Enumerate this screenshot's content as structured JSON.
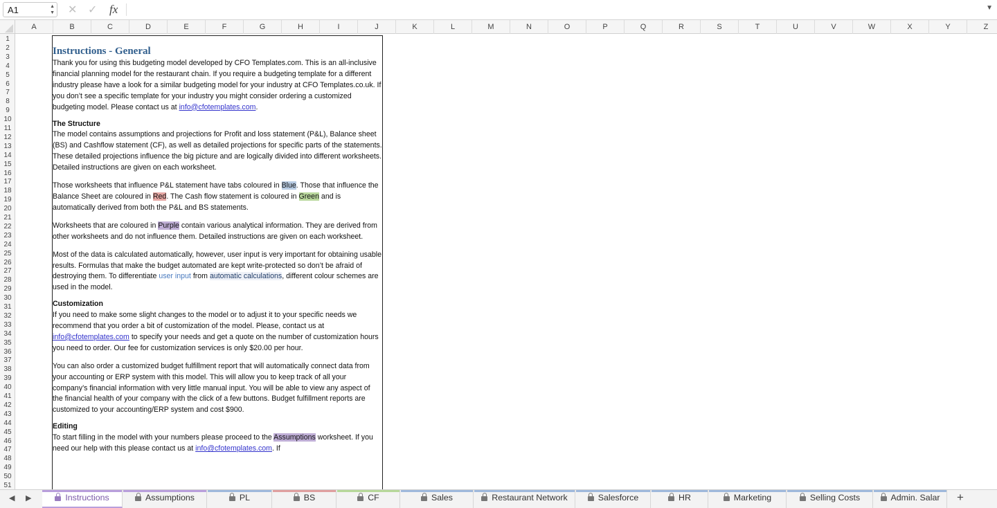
{
  "formula_bar": {
    "name_box": "A1",
    "fx_label": "fx",
    "formula": ""
  },
  "columns": [
    "A",
    "B",
    "C",
    "D",
    "E",
    "F",
    "G",
    "H",
    "I",
    "J",
    "K",
    "L",
    "M",
    "N",
    "O",
    "P",
    "Q",
    "R",
    "S",
    "T",
    "U",
    "V",
    "W",
    "X",
    "Y",
    "Z"
  ],
  "rows": [
    "1",
    "2",
    "3",
    "4",
    "5",
    "6",
    "7",
    "8",
    "9",
    "10",
    "11",
    "12",
    "13",
    "14",
    "15",
    "16",
    "17",
    "18",
    "19",
    "20",
    "21",
    "22",
    "23",
    "24",
    "25",
    "26",
    "27",
    "28",
    "29",
    "30",
    "31",
    "32",
    "33",
    "34",
    "35",
    "36",
    "37",
    "38",
    "39",
    "40",
    "41",
    "42",
    "43",
    "44",
    "45",
    "46",
    "47",
    "48",
    "49",
    "50",
    "51"
  ],
  "content": {
    "title": "Instructions - General",
    "intro": {
      "text": "Thank you for using this budgeting model developed by CFO Templates.com. This is an all-inclusive financial planning model for the restaurant chain. If you require a budgeting template for a different industry please have a look for a similar budgeting model for your industry at CFO Templates.co.uk. If you don’t see a specific template for your industry you might consider ordering a customized budgeting model. Please contact us at",
      "email": "info@cfotemplates.com",
      "end": "."
    },
    "structure_heading": "The Structure",
    "structure_text": "The model contains assumptions and projections for Profit and loss statement (P&L), Balance sheet (BS) and Cashflow statement (CF), as well as detailed projections for specific parts of the statements. These detailed projections influence the big picture and are logically divided into different worksheets. Detailed instructions are given on each worksheet.",
    "colours": {
      "t1": "Those worksheets that influence P&L statement have tabs coloured in",
      "blue": "Blue",
      "t2": ". Those that influence the Balance Sheet are coloured in",
      "red": "Red",
      "t3": ". The Cash flow statement is coloured in",
      "green": "Green",
      "t4": "and is automatically derived from both the P&L and BS statements."
    },
    "purple": {
      "t1": "Worksheets that are coloured in",
      "purple": "Purple",
      "t2": "contain various analytical information. They are derived from other worksheets and do not influence them. Detailed instructions are given on each worksheet."
    },
    "auto": {
      "t1": "Most of the data is calculated automatically, however, user input is very important for obtaining usable results. Formulas that make the budget automated are kept write-protected so don’t be afraid of destroying them. To differentiate",
      "user_input": "user input",
      "t2": "from",
      "automatic": "automatic calculations",
      "t3": ", different colour schemes are used in the model."
    },
    "custom_heading": "Customization",
    "custom": {
      "t1": "If you need to make some slight changes to the model or to adjust it to your specific needs we recommend that you order a bit of customization of the model. Please, contact us at",
      "email": "info@cfotemplates.com",
      "t2": "to specify your needs and get a quote on the number of customization hours you need to order. Our fee for customization services is only $20.00 per hour."
    },
    "report_text": "You can also order a customized budget fulfillment report that will automatically connect data from your accounting or ERP system with this model. This will allow you to keep track of all your company’s financial information with very little manual input. You will be able to view any aspect of the financial health of your company with the click of a few buttons. Budget fulfillment reports are customized to your accounting/ERP system and cost $900.",
    "editing_heading": "Editing",
    "editing": {
      "t1": "To start filling in the model with your numbers please proceed to the",
      "assumptions": "Assumptions",
      "t2": "worksheet. If you need our help with this please contact us at",
      "email": "info@cfotemplates.com",
      "t3": ". If"
    }
  },
  "tabs": [
    {
      "label": "Instructions",
      "color": "#b99fdc",
      "active": true
    },
    {
      "label": "Assumptions",
      "color": "#b99fdc"
    },
    {
      "label": "PL",
      "color": "#9fb9dc"
    },
    {
      "label": "BS",
      "color": "#e0a0a0"
    },
    {
      "label": "CF",
      "color": "#b7d89a"
    },
    {
      "label": "Sales",
      "color": "#9fb9dc"
    },
    {
      "label": "Restaurant Network",
      "color": "#9fb9dc"
    },
    {
      "label": "Salesforce",
      "color": "#9fb9dc"
    },
    {
      "label": "HR",
      "color": "#9fb9dc"
    },
    {
      "label": "Marketing",
      "color": "#9fb9dc"
    },
    {
      "label": "Selling Costs",
      "color": "#9fb9dc"
    },
    {
      "label": "Admin. Salar",
      "color": "#9fb9dc"
    }
  ],
  "add_tab_label": "+"
}
